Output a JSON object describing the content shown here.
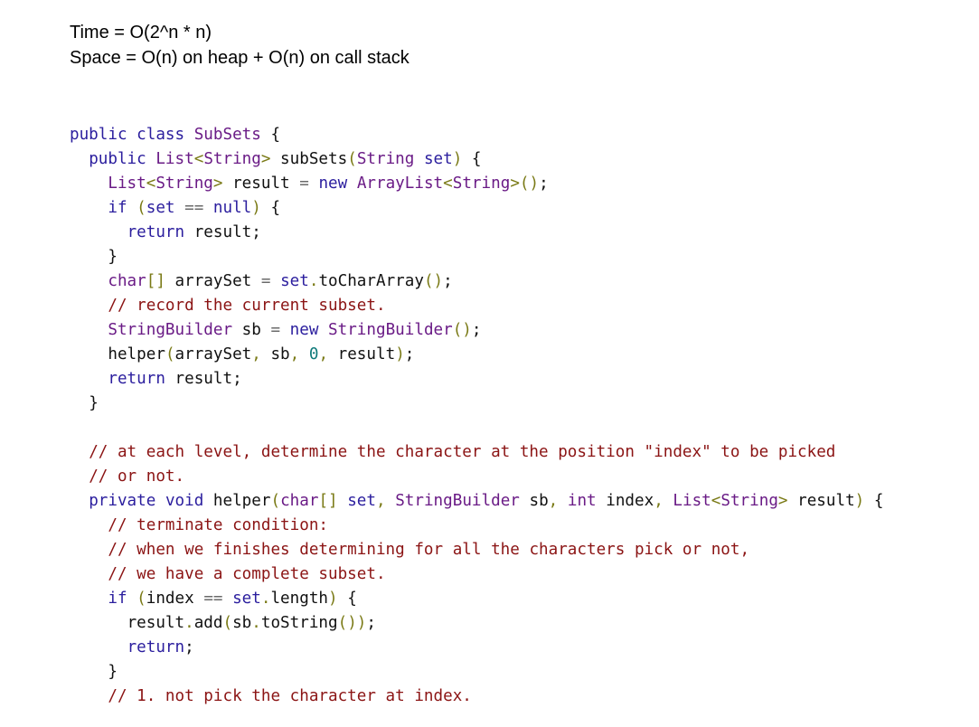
{
  "complexity": {
    "time": "Time = O(2^n * n)",
    "space": "Space = O(n) on heap + O(n) on call stack"
  },
  "colors": {
    "keyword": "#2b1e9e",
    "type": "#6a1b86",
    "identifier": "#111111",
    "punctuation": "#7a7a16",
    "operator": "#6a6a6a",
    "comment": "#8b1414",
    "string": "#8b1414",
    "number": "#0f7a7a"
  },
  "code_lines": [
    {
      "indent": 0,
      "tokens": [
        [
          "kw",
          "public"
        ],
        [
          "id",
          " "
        ],
        [
          "kw",
          "class"
        ],
        [
          "id",
          " "
        ],
        [
          "ty",
          "SubSets"
        ],
        [
          "id",
          " {"
        ]
      ]
    },
    {
      "indent": 1,
      "tokens": [
        [
          "kw",
          "public"
        ],
        [
          "id",
          " "
        ],
        [
          "ty",
          "List"
        ],
        [
          "pu",
          "<"
        ],
        [
          "ty",
          "String"
        ],
        [
          "pu",
          ">"
        ],
        [
          "id",
          " subSets"
        ],
        [
          "pu",
          "("
        ],
        [
          "ty",
          "String"
        ],
        [
          "id",
          " "
        ],
        [
          "kw",
          "set"
        ],
        [
          "pu",
          ")"
        ],
        [
          "id",
          " {"
        ]
      ]
    },
    {
      "indent": 2,
      "tokens": [
        [
          "ty",
          "List"
        ],
        [
          "pu",
          "<"
        ],
        [
          "ty",
          "String"
        ],
        [
          "pu",
          ">"
        ],
        [
          "id",
          " result "
        ],
        [
          "op",
          "="
        ],
        [
          "id",
          " "
        ],
        [
          "kw",
          "new"
        ],
        [
          "id",
          " "
        ],
        [
          "ty",
          "ArrayList"
        ],
        [
          "pu",
          "<"
        ],
        [
          "ty",
          "String"
        ],
        [
          "pu",
          ">"
        ],
        [
          "pu",
          "()"
        ],
        [
          "id",
          ";"
        ]
      ]
    },
    {
      "indent": 2,
      "tokens": [
        [
          "kw",
          "if"
        ],
        [
          "id",
          " "
        ],
        [
          "pu",
          "("
        ],
        [
          "kw",
          "set"
        ],
        [
          "id",
          " "
        ],
        [
          "op",
          "=="
        ],
        [
          "id",
          " "
        ],
        [
          "kw",
          "null"
        ],
        [
          "pu",
          ")"
        ],
        [
          "id",
          " {"
        ]
      ]
    },
    {
      "indent": 3,
      "tokens": [
        [
          "kw",
          "return"
        ],
        [
          "id",
          " result;"
        ]
      ]
    },
    {
      "indent": 2,
      "tokens": [
        [
          "id",
          "}"
        ]
      ]
    },
    {
      "indent": 2,
      "tokens": [
        [
          "ty",
          "char"
        ],
        [
          "pu",
          "[]"
        ],
        [
          "id",
          " arraySet "
        ],
        [
          "op",
          "="
        ],
        [
          "id",
          " "
        ],
        [
          "kw",
          "set"
        ],
        [
          "pu",
          "."
        ],
        [
          "id",
          "toCharArray"
        ],
        [
          "pu",
          "()"
        ],
        [
          "id",
          ";"
        ]
      ]
    },
    {
      "indent": 2,
      "tokens": [
        [
          "cm",
          "// record the current subset."
        ]
      ]
    },
    {
      "indent": 2,
      "tokens": [
        [
          "ty",
          "StringBuilder"
        ],
        [
          "id",
          " sb "
        ],
        [
          "op",
          "="
        ],
        [
          "id",
          " "
        ],
        [
          "kw",
          "new"
        ],
        [
          "id",
          " "
        ],
        [
          "ty",
          "StringBuilder"
        ],
        [
          "pu",
          "()"
        ],
        [
          "id",
          ";"
        ]
      ]
    },
    {
      "indent": 2,
      "tokens": [
        [
          "id",
          "helper"
        ],
        [
          "pu",
          "("
        ],
        [
          "id",
          "arraySet"
        ],
        [
          "pu",
          ","
        ],
        [
          "id",
          " sb"
        ],
        [
          "pu",
          ","
        ],
        [
          "id",
          " "
        ],
        [
          "nu",
          "0"
        ],
        [
          "pu",
          ","
        ],
        [
          "id",
          " result"
        ],
        [
          "pu",
          ")"
        ],
        [
          "id",
          ";"
        ]
      ]
    },
    {
      "indent": 2,
      "tokens": [
        [
          "kw",
          "return"
        ],
        [
          "id",
          " result;"
        ]
      ]
    },
    {
      "indent": 1,
      "tokens": [
        [
          "id",
          "}"
        ]
      ]
    },
    {
      "indent": 0,
      "tokens": []
    },
    {
      "indent": 1,
      "tokens": [
        [
          "cm",
          "// at each level, determine the character at the position "
        ],
        [
          "st",
          "\"index\""
        ],
        [
          "cm",
          " to be picked"
        ]
      ]
    },
    {
      "indent": 1,
      "tokens": [
        [
          "cm",
          "// or not."
        ]
      ]
    },
    {
      "indent": 1,
      "tokens": [
        [
          "kw",
          "private"
        ],
        [
          "id",
          " "
        ],
        [
          "kw",
          "void"
        ],
        [
          "id",
          " helper"
        ],
        [
          "pu",
          "("
        ],
        [
          "ty",
          "char"
        ],
        [
          "pu",
          "[]"
        ],
        [
          "id",
          " "
        ],
        [
          "kw",
          "set"
        ],
        [
          "pu",
          ","
        ],
        [
          "id",
          " "
        ],
        [
          "ty",
          "StringBuilder"
        ],
        [
          "id",
          " sb"
        ],
        [
          "pu",
          ","
        ],
        [
          "id",
          " "
        ],
        [
          "ty",
          "int"
        ],
        [
          "id",
          " index"
        ],
        [
          "pu",
          ","
        ],
        [
          "id",
          " "
        ],
        [
          "ty",
          "List"
        ],
        [
          "pu",
          "<"
        ],
        [
          "ty",
          "String"
        ],
        [
          "pu",
          ">"
        ],
        [
          "id",
          " result"
        ],
        [
          "pu",
          ")"
        ],
        [
          "id",
          " {"
        ]
      ]
    },
    {
      "indent": 2,
      "tokens": [
        [
          "cm",
          "// terminate condition:"
        ]
      ]
    },
    {
      "indent": 2,
      "tokens": [
        [
          "cm",
          "// when we finishes determining for all the characters pick or not,"
        ]
      ]
    },
    {
      "indent": 2,
      "tokens": [
        [
          "cm",
          "// we have a complete subset."
        ]
      ]
    },
    {
      "indent": 2,
      "tokens": [
        [
          "kw",
          "if"
        ],
        [
          "id",
          " "
        ],
        [
          "pu",
          "("
        ],
        [
          "id",
          "index "
        ],
        [
          "op",
          "=="
        ],
        [
          "id",
          " "
        ],
        [
          "kw",
          "set"
        ],
        [
          "pu",
          "."
        ],
        [
          "id",
          "length"
        ],
        [
          "pu",
          ")"
        ],
        [
          "id",
          " {"
        ]
      ]
    },
    {
      "indent": 3,
      "tokens": [
        [
          "id",
          "result"
        ],
        [
          "pu",
          "."
        ],
        [
          "id",
          "add"
        ],
        [
          "pu",
          "("
        ],
        [
          "id",
          "sb"
        ],
        [
          "pu",
          "."
        ],
        [
          "id",
          "toString"
        ],
        [
          "pu",
          "())"
        ],
        [
          "id",
          ";"
        ]
      ]
    },
    {
      "indent": 3,
      "tokens": [
        [
          "kw",
          "return"
        ],
        [
          "id",
          ";"
        ]
      ]
    },
    {
      "indent": 2,
      "tokens": [
        [
          "id",
          "}"
        ]
      ]
    },
    {
      "indent": 2,
      "tokens": [
        [
          "cm",
          "// 1. not pick the character at index."
        ]
      ]
    }
  ]
}
